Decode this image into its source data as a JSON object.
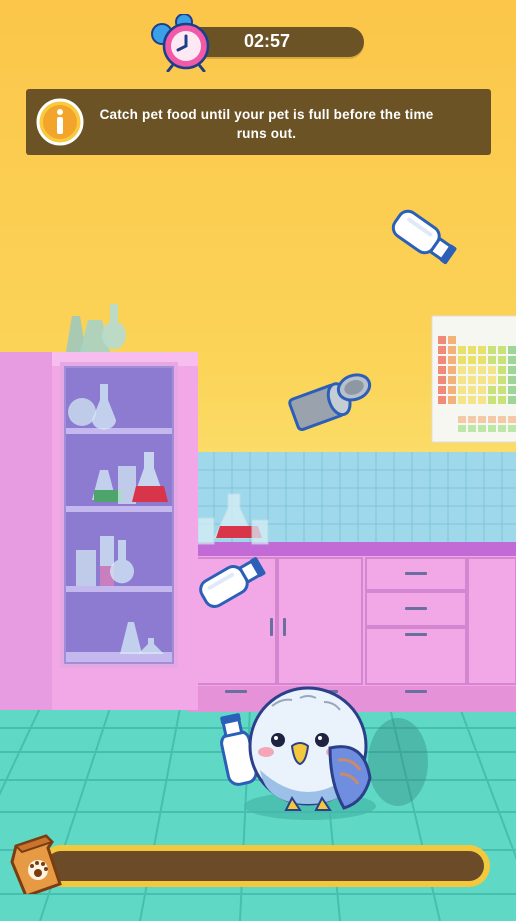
{
  "timer": {
    "label": "02:57",
    "icon": "alarm-clock-icon"
  },
  "instruction": {
    "text": "Catch pet food until your pet is full before the time runs out.",
    "icon": "info-icon"
  },
  "fullness": {
    "icon": "pet-food-bag-icon",
    "progress": 0
  },
  "colors": {
    "panel": "#6b5326",
    "wall": "#fbd458",
    "floor": "#5fd9c6",
    "cabinet": "#f2a7e6",
    "accent": "#f3c83d"
  }
}
